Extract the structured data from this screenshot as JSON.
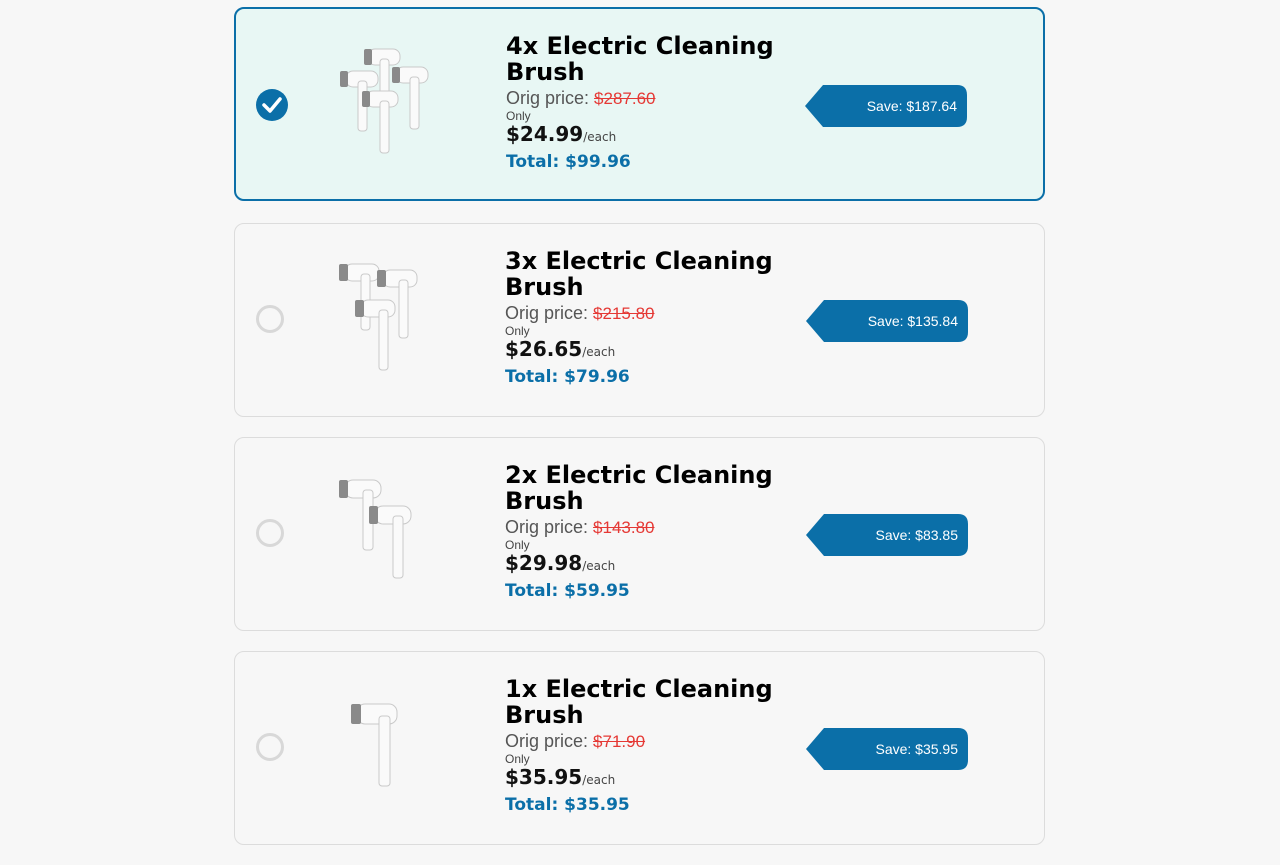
{
  "colors": {
    "accent": "#0b6fa8",
    "selected_bg": "#e8f7f4",
    "strike": "#e53935"
  },
  "bundles": [
    {
      "title": "4x Electric Cleaning Brush",
      "orig_label": "Orig price:",
      "orig_price": "$287.60",
      "only": "Only",
      "price": "$24.99",
      "each": "/each",
      "total": "Total: $99.96",
      "save": "Save: $187.64",
      "selected": true,
      "image_icon": "electric-brush-4-pack-icon"
    },
    {
      "title": "3x Electric Cleaning Brush",
      "orig_label": "Orig price:",
      "orig_price": "$215.80",
      "only": "Only",
      "price": "$26.65",
      "each": "/each",
      "total": "Total: $79.96",
      "save": "Save: $135.84",
      "selected": false,
      "image_icon": "electric-brush-3-pack-icon"
    },
    {
      "title": "2x Electric Cleaning Brush",
      "orig_label": "Orig price:",
      "orig_price": "$143.80",
      "only": "Only",
      "price": "$29.98",
      "each": "/each",
      "total": "Total: $59.95",
      "save": "Save: $83.85",
      "selected": false,
      "image_icon": "electric-brush-2-pack-icon"
    },
    {
      "title": "1x Electric Cleaning Brush",
      "orig_label": "Orig price:",
      "orig_price": "$71.90",
      "only": "Only",
      "price": "$35.95",
      "each": "/each",
      "total": "Total: $35.95",
      "save": "Save: $35.95",
      "selected": false,
      "image_icon": "electric-brush-1-pack-icon"
    }
  ]
}
